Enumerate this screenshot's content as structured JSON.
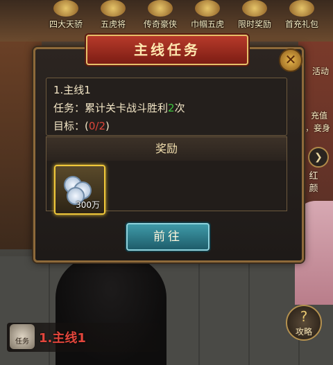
{
  "top_activities": [
    {
      "label": "四大天骄"
    },
    {
      "label": "五虎将"
    },
    {
      "label": "传奇豪侠"
    },
    {
      "label": "巾帼五虎"
    },
    {
      "label": "限时奖励"
    },
    {
      "label": "首充礼包"
    }
  ],
  "side": {
    "activity_text": "活动",
    "recharge_text": "充值",
    "extra_text": "，妾身",
    "beauty_label": "红颜"
  },
  "dialog": {
    "title": "主线任务",
    "quest_name": "1.主线1",
    "task_prefix": "任务：",
    "task_text": "累计关卡战斗胜利",
    "task_count": "2",
    "task_suffix": "次",
    "goal_prefix": "目标：",
    "goal_open": "(",
    "goal_progress": "0/2",
    "goal_close": ")",
    "reward_header": "奖励",
    "reward_item": {
      "name_icon": "silver-coins-icon",
      "quantity": "300万"
    },
    "go_button": "前往"
  },
  "bottom": {
    "task_icon_label": "任务",
    "current_task": "1.主线1",
    "strategy_label": "攻略"
  },
  "colors": {
    "banner": "#b73a2a",
    "go_button": "#2f7f8d",
    "highlight_green": "#3ec83e",
    "highlight_red": "#e0463a"
  }
}
